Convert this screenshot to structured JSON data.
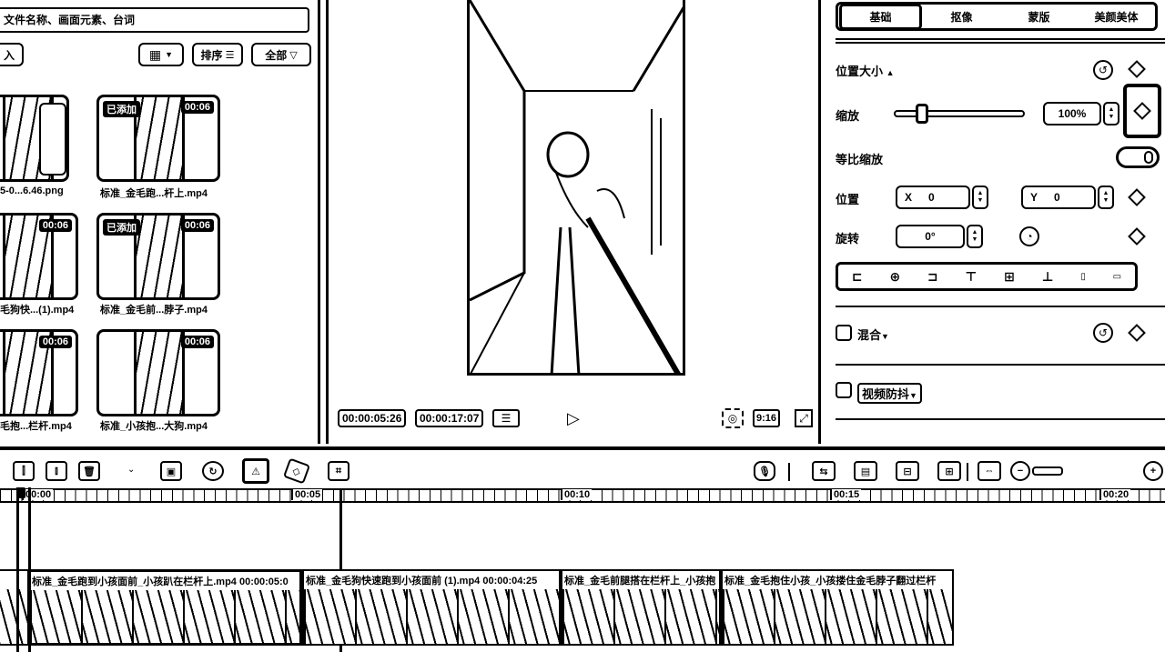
{
  "media": {
    "search_placeholder": "文件名称、画面元素、台词",
    "import_label": "入",
    "sort_label": "排序",
    "all_label": "全部",
    "items": [
      {
        "name": "5-0...6.46.png",
        "badge_left": "",
        "badge_right": ""
      },
      {
        "name": "标准_金毛跑...杆上.mp4",
        "badge_left": "已添加",
        "badge_right": "00:06"
      },
      {
        "name": "毛狗快...(1).mp4",
        "badge_left": "",
        "badge_right": "00:06"
      },
      {
        "name": "标准_金毛前...脖子.mp4",
        "badge_left": "已添加",
        "badge_right": "00:06"
      },
      {
        "name": "毛抱...栏杆.mp4",
        "badge_left": "",
        "badge_right": "00:06"
      },
      {
        "name": "标准_小孩抱...大狗.mp4",
        "badge_left": "",
        "badge_right": "00:06"
      }
    ]
  },
  "preview": {
    "current_time": "00:00:05:26",
    "total_time": "00:00:17:07",
    "ratio": "9:16"
  },
  "inspector": {
    "tabs": [
      "基础",
      "抠像",
      "蒙版",
      "美颜美体"
    ],
    "position_size_label": "位置大小",
    "scale_label": "缩放",
    "scale_value": "100%",
    "uniform_scale_label": "等比缩放",
    "position_label": "位置",
    "x_label": "X",
    "x_value": "0",
    "y_label": "Y",
    "y_value": "0",
    "rotation_label": "旋转",
    "rotation_value": "0°",
    "blend_label": "混合",
    "stabilize_label": "视频防抖"
  },
  "timeline": {
    "ticks": [
      "00:00",
      "00:05",
      "00:10",
      "00:15",
      "00:20"
    ],
    "clips": [
      {
        "title": "标准_金毛跑到小孩面前_小孩趴在栏杆上.mp4  00:00:05:0"
      },
      {
        "title": "标准_金毛狗快速跑到小孩面前 (1).mp4  00:00:04:25"
      },
      {
        "title": "标准_金毛前腿搭在栏杆上_小孩抱"
      },
      {
        "title": "标准_金毛抱住小孩_小孩搂住金毛脖子翻过栏杆"
      }
    ]
  }
}
